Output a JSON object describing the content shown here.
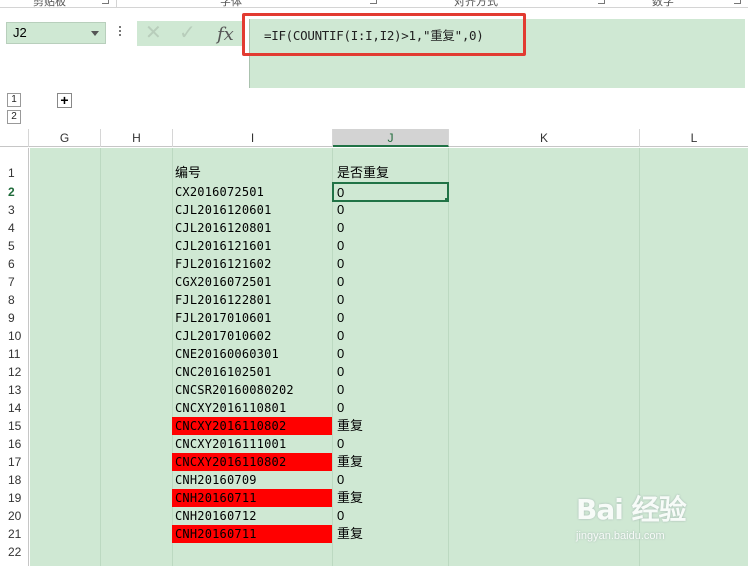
{
  "ribbon": {
    "groups": [
      "剪贴板",
      "字体",
      "对齐方式",
      "数字"
    ]
  },
  "formula_bar": {
    "name_box": "J2",
    "cancel_icon": "x-icon",
    "enter_icon": "check-icon",
    "function_label": "fx",
    "formula": "=IF(COUNTIF(I:I,I2)>1,\"重复\",0)"
  },
  "outline": {
    "levels": [
      "1",
      "2"
    ],
    "expand_label": "+"
  },
  "columns": [
    "G",
    "H",
    "I",
    "J",
    "K",
    "L"
  ],
  "active_column": "J",
  "rows": [
    {
      "num": "1",
      "code": "编号",
      "dup": "是否重复",
      "red": false
    },
    {
      "num": "2",
      "code": "CX2016072501",
      "dup": "0",
      "red": false
    },
    {
      "num": "3",
      "code": "CJL2016120601",
      "dup": "0",
      "red": false
    },
    {
      "num": "4",
      "code": "CJL2016120801",
      "dup": "0",
      "red": false
    },
    {
      "num": "5",
      "code": "CJL2016121601",
      "dup": "0",
      "red": false
    },
    {
      "num": "6",
      "code": "FJL2016121602",
      "dup": "0",
      "red": false
    },
    {
      "num": "7",
      "code": "CGX2016072501",
      "dup": "0",
      "red": false
    },
    {
      "num": "8",
      "code": "FJL2016122801",
      "dup": "0",
      "red": false
    },
    {
      "num": "9",
      "code": "FJL2017010601",
      "dup": "0",
      "red": false
    },
    {
      "num": "10",
      "code": "CJL2017010602",
      "dup": "0",
      "red": false
    },
    {
      "num": "11",
      "code": "CNE20160060301",
      "dup": "0",
      "red": false
    },
    {
      "num": "12",
      "code": "CNC2016102501",
      "dup": "0",
      "red": false
    },
    {
      "num": "13",
      "code": "CNCSR20160080202",
      "dup": "0",
      "red": false
    },
    {
      "num": "14",
      "code": "CNCXY2016110801",
      "dup": "0",
      "red": false
    },
    {
      "num": "15",
      "code": "CNCXY2016110802",
      "dup": "重复",
      "red": true
    },
    {
      "num": "16",
      "code": "CNCXY2016111001",
      "dup": "0",
      "red": false
    },
    {
      "num": "17",
      "code": "CNCXY2016110802",
      "dup": "重复",
      "red": true
    },
    {
      "num": "18",
      "code": "CNH20160709",
      "dup": "0",
      "red": false
    },
    {
      "num": "19",
      "code": "CNH20160711",
      "dup": "重复",
      "red": true
    },
    {
      "num": "20",
      "code": "CNH20160712",
      "dup": "0",
      "red": false
    },
    {
      "num": "21",
      "code": "CNH20160711",
      "dup": "重复",
      "red": true
    },
    {
      "num": "22",
      "code": "",
      "dup": "",
      "red": false
    }
  ],
  "colors": {
    "grid_fill": "#cfe8d3",
    "duplicate_highlight": "#ff0000",
    "selection": "#217346",
    "callout": "#e23b31"
  },
  "watermark": {
    "logo": "Bai 经验",
    "url": "jingyan.baidu.com"
  }
}
